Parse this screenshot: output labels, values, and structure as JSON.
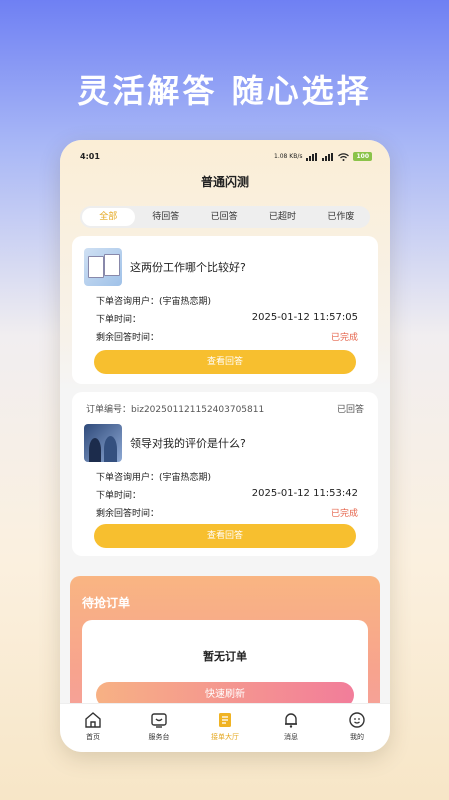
{
  "headline": "灵活解答 随心选择",
  "status_bar": {
    "time": "4:01",
    "speed": "1.08 KB/s",
    "battery": "100"
  },
  "nav_title": "普通闪测",
  "tabs": [
    "全部",
    "待回答",
    "已回答",
    "已超时",
    "已作废"
  ],
  "active_tab": 0,
  "cards": [
    {
      "question": "这两份工作哪个比较好?",
      "user_label": "下单咨询用户：",
      "user_value": "(宇宙热恋期)",
      "time_label": "下单时间：",
      "time_value": "2025-01-12 11:57:05",
      "remain_label": "剩余回答时间：",
      "remain_value": "已完成",
      "button": "查看回答"
    },
    {
      "order_label": "订单编号：",
      "order_no": "biz20250112115240370581​1",
      "status": "已回答",
      "question": "领导对我的评价是什么?",
      "user_label": "下单咨询用户：",
      "user_value": "(宇宙热恋期)",
      "time_label": "下单时间：",
      "time_value": "2025-01-12 11:53:42",
      "remain_label": "剩余回答时间：",
      "remain_value": "已完成",
      "button": "查看回答"
    }
  ],
  "grab": {
    "title": "待抢订单",
    "empty": "暂无订单",
    "refresh": "快速刷新"
  },
  "tabbar": [
    {
      "label": "首页",
      "icon": "home-icon"
    },
    {
      "label": "服务台",
      "icon": "service-desk-icon"
    },
    {
      "label": "接单大厅",
      "icon": "order-hall-icon"
    },
    {
      "label": "消息",
      "icon": "bell-icon"
    },
    {
      "label": "我的",
      "icon": "profile-icon"
    }
  ],
  "active_tabbar": 2,
  "colors": {
    "accent": "#f7bf2f",
    "done": "#e5634a"
  }
}
